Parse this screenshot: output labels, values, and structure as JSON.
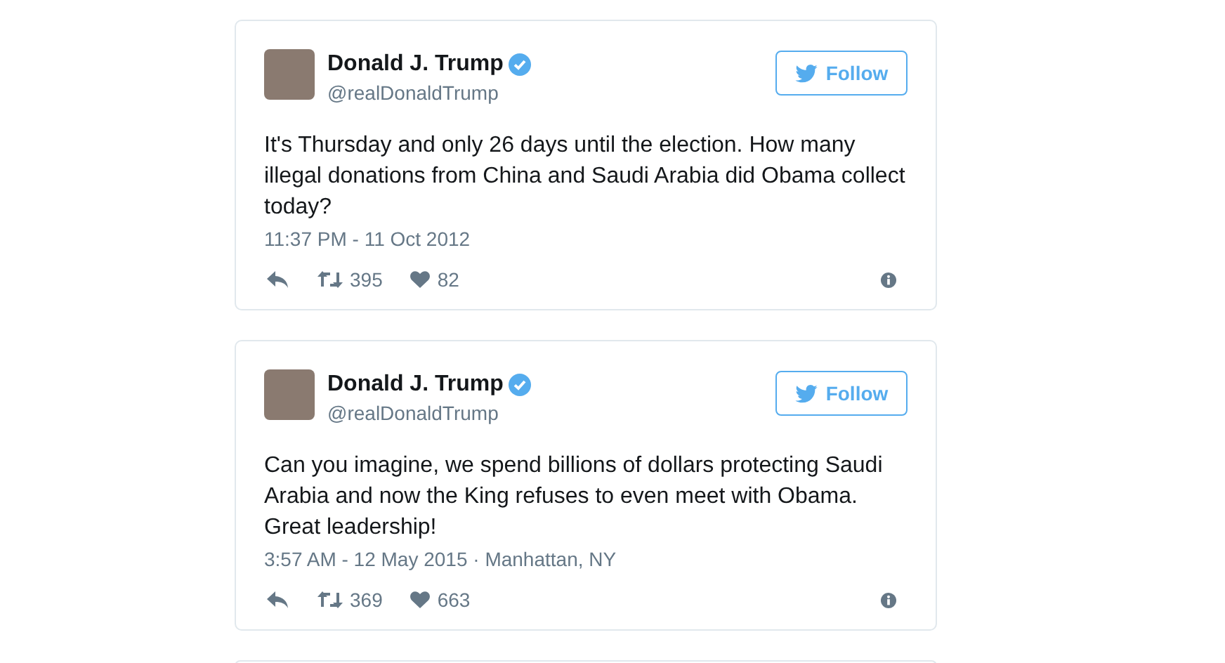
{
  "tweets": [
    {
      "name": "Donald J. Trump",
      "verified": true,
      "handle": "@realDonaldTrump",
      "follow_label": "Follow",
      "text": "It's Thursday and only 26 days until the election. How many illegal donations from China and Saudi Arabia did Obama collect today?",
      "timestamp": "11:37 PM - 11 Oct 2012",
      "retweets": "395",
      "likes": "82"
    },
    {
      "name": "Donald J. Trump",
      "verified": true,
      "handle": "@realDonaldTrump",
      "follow_label": "Follow",
      "text": "Can you imagine, we spend billions of dollars protecting Saudi Arabia and now the King refuses to even meet with Obama. Great leadership!",
      "timestamp": "3:57 AM - 12 May 2015 · Manhattan, NY",
      "retweets": "369",
      "likes": "663"
    }
  ]
}
